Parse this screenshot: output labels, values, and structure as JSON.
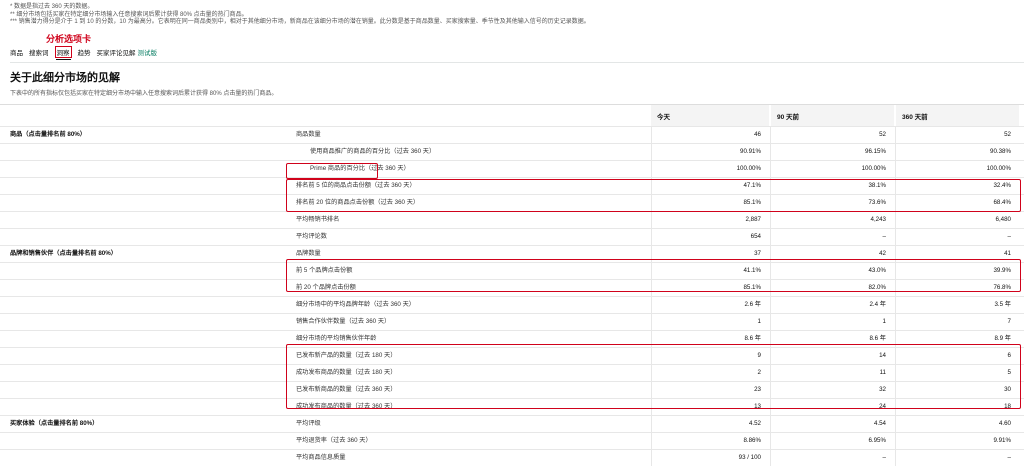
{
  "notes": [
    "* 数据是指过去 360 天的数据。",
    "** 细分市场包括买家在特定细分市场输入任意搜索词后累计获得 80% 点击量的热门商品。",
    "*** 销售潜力得分是介于 1 到 10 的分数，10 为最高分。它表明在同一商品类别中，相对于其他细分市场，新商品在该细分市场的潜在销量。此分数是基于商品数量、买家搜索量、季节性及其他输入信号的历史记录数据。"
  ],
  "tabs": [
    {
      "label": "商品"
    },
    {
      "label": "搜索词"
    },
    {
      "label": "洞察",
      "active": true
    },
    {
      "label": "趋势"
    },
    {
      "label": "买家评论见解",
      "beta": "测试版"
    }
  ],
  "callout": "分析选项卡",
  "section": {
    "title": "关于此细分市场的见解",
    "desc": "下表中的所有指标仅包括买家在特定细分市场中输入任意搜索词后累计获得 80% 点击量的热门商品。"
  },
  "table": {
    "headers": [
      "今天",
      "90 天前",
      "360 天前"
    ],
    "rows": [
      {
        "section": "商品（点击量排名前 80%）",
        "metric": "商品数量",
        "v": [
          "46",
          "52",
          "52"
        ]
      },
      {
        "section": "",
        "metric": "使用商品推广的商品的百分比（过去 360 天）",
        "indent": true,
        "v": [
          "90.91%",
          "96.15%",
          "90.38%"
        ]
      },
      {
        "section": "",
        "metric": "Prime 商品的百分比（过去 360 天）",
        "indent": true,
        "v": [
          "100.00%",
          "100.00%",
          "100.00%"
        ]
      },
      {
        "section": "",
        "metric": "排名前 5 位的商品点击份额（过去 360 天）",
        "v": [
          "47.1%",
          "38.1%",
          "32.4%"
        ]
      },
      {
        "section": "",
        "metric": "排名前 20 位的商品点击份额（过去 360 天）",
        "v": [
          "85.1%",
          "73.6%",
          "68.4%"
        ]
      },
      {
        "section": "",
        "metric": "平均畅销书排名",
        "v": [
          "2,887",
          "4,243",
          "6,480"
        ]
      },
      {
        "section": "",
        "metric": "平均评论数",
        "v": [
          "654",
          "–",
          "–"
        ]
      },
      {
        "section": "品牌和销售伙伴（点击量排名前 80%）",
        "metric": "品牌数量",
        "v": [
          "37",
          "42",
          "41"
        ]
      },
      {
        "section": "",
        "metric": "前 5 个品牌点击份额",
        "v": [
          "41.1%",
          "43.0%",
          "39.9%"
        ]
      },
      {
        "section": "",
        "metric": "前 20 个品牌点击份额",
        "v": [
          "85.1%",
          "82.0%",
          "76.8%"
        ]
      },
      {
        "section": "",
        "metric": "细分市场中的平均品牌年龄（过去 360 天）",
        "v": [
          "2.6 年",
          "2.4 年",
          "3.5 年"
        ]
      },
      {
        "section": "",
        "metric": "销售合作伙伴数量（过去 360 天）",
        "v": [
          "1",
          "1",
          "7"
        ]
      },
      {
        "section": "",
        "metric": "细分市场的平均销售伙伴年龄",
        "v": [
          "8.6 年",
          "8.6 年",
          "8.9 年"
        ]
      },
      {
        "section": "",
        "metric": "已发布新产品的数量（过去 180 天）",
        "v": [
          "9",
          "14",
          "6"
        ]
      },
      {
        "section": "",
        "metric": "成功发布商品的数量（过去 180 天）",
        "v": [
          "2",
          "11",
          "5"
        ]
      },
      {
        "section": "",
        "metric": "已发布新商品的数量（过去 360 天）",
        "v": [
          "23",
          "32",
          "30"
        ]
      },
      {
        "section": "",
        "metric": "成功发布商品的数量（过去 360 天）",
        "v": [
          "13",
          "24",
          "18"
        ]
      },
      {
        "section": "买家体验（点击量排名前 80%）",
        "metric": "平均评级",
        "v": [
          "4.52",
          "4.54",
          "4.60"
        ]
      },
      {
        "section": "",
        "metric": "平均退货率（过去 360 天）",
        "v": [
          "8.86%",
          "6.95%",
          "9.91%"
        ]
      },
      {
        "section": "",
        "metric": "平均商品信息质量",
        "v": [
          "93 / 100",
          "–",
          "–"
        ]
      }
    ]
  },
  "colors": {
    "highlight": "#d0021b",
    "accent": "#067d62"
  }
}
